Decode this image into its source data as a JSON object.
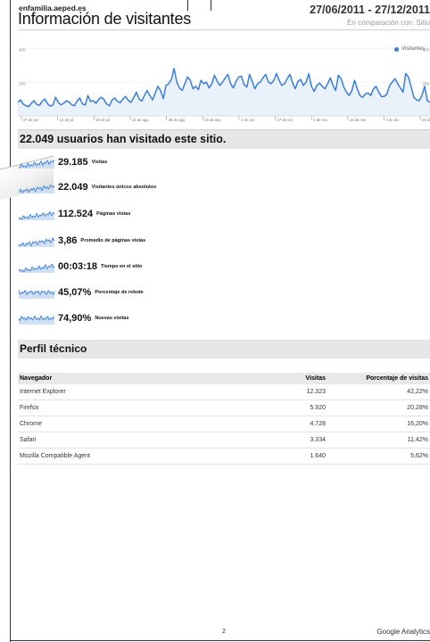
{
  "header": {
    "site": "enfamilia.aeped.es",
    "title": "Información de visitantes",
    "date_range": "27/06/2011 - 27/12/2011",
    "comparison": "En comparación con: Sitio"
  },
  "chart_data": {
    "type": "line",
    "y_ticks": [
      "400",
      "200"
    ],
    "y_ticks_right": [
      "400",
      "200"
    ],
    "x_ticks": [
      "27 de jun",
      "13 de jul",
      "29 de jul",
      "14 de ago",
      "30 de ago",
      "15 de sep",
      "1 de oct",
      "17 de oct",
      "2 de nov",
      "18 de nov",
      "4 de dic",
      "20 de d"
    ],
    "legend": "Visitantes",
    "ylim": [
      0,
      400
    ],
    "series": [
      {
        "name": "Visitantes",
        "values": [
          80,
          95,
          70,
          60,
          55,
          75,
          90,
          68,
          62,
          85,
          100,
          72,
          58,
          64,
          110,
          80,
          66,
          74,
          90,
          82,
          66,
          60,
          88,
          105,
          70,
          64,
          120,
          85,
          90,
          75,
          98,
          110,
          96,
          70,
          60,
          95,
          105,
          85,
          78,
          100,
          115,
          92,
          80,
          108,
          140,
          100,
          88,
          120,
          150,
          120,
          95,
          135,
          175,
          150,
          102,
          180,
          190,
          215,
          280,
          200,
          165,
          150,
          190,
          230,
          210,
          160,
          175,
          155,
          210,
          190,
          200,
          165,
          190,
          240,
          205,
          180,
          200,
          225,
          245,
          190,
          165,
          205,
          230,
          235,
          185,
          170,
          245,
          205,
          160,
          190,
          200,
          225,
          245,
          200,
          190,
          210,
          250,
          210,
          180,
          190,
          220,
          245,
          195,
          160,
          205,
          215,
          180,
          200,
          250,
          175,
          145,
          180,
          195,
          175,
          160,
          190,
          225,
          180,
          150,
          240,
          220,
          170,
          140,
          120,
          150,
          210,
          160,
          120,
          110,
          130,
          135,
          120,
          160,
          175,
          140,
          115,
          115,
          130,
          180,
          200,
          220,
          190,
          165,
          140,
          250,
          230,
          170,
          110,
          95,
          90,
          120,
          175,
          90,
          80
        ]
      }
    ]
  },
  "summary": "22.049 usuarios han visitado este sitio.",
  "metrics": [
    {
      "value": "29.185",
      "label": "Visitas"
    },
    {
      "value": "22.049",
      "label": "Visitantes únicos absolutos"
    },
    {
      "value": "112.524",
      "label": "Páginas vistas"
    },
    {
      "value": "3,86",
      "label": "Promedio de páginas vistas"
    },
    {
      "value": "00:03:18",
      "label": "Tiempo en el sitio"
    },
    {
      "value": "45,07%",
      "label": "Porcentaje de rebote"
    },
    {
      "value": "74,90%",
      "label": "Nuevas visitas"
    }
  ],
  "tech_profile": {
    "title": "Perfil técnico",
    "headers": [
      "Navegador",
      "Visitas",
      "Porcentaje de visitas"
    ],
    "rows": [
      [
        "Internet Explorer",
        "12.323",
        "42,22%"
      ],
      [
        "Firefox",
        "5.920",
        "20,28%"
      ],
      [
        "Chrome",
        "4.728",
        "16,20%"
      ],
      [
        "Safari",
        "3.334",
        "11,42%"
      ],
      [
        "Mozilla Compatible Agent",
        "1.640",
        "5,62%"
      ]
    ]
  },
  "footer": {
    "page_number": "2",
    "brand": "Google Analytics"
  },
  "colors": {
    "line": "#3b7dd8",
    "fill": "#cfe0f5",
    "bar_bg": "#e6e6e6"
  }
}
